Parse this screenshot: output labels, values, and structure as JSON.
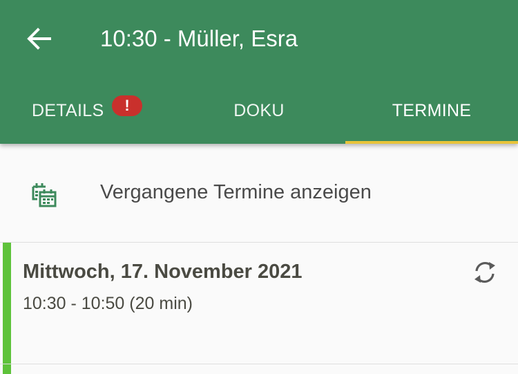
{
  "header": {
    "title": "10:30 - Müller, Esra",
    "back_icon": "arrow-left-icon",
    "background_color": "#3d8a5c"
  },
  "tabs": [
    {
      "label": "DETAILS",
      "badge": "!",
      "active": false
    },
    {
      "label": "DOKU",
      "active": false
    },
    {
      "label": "TERMINE",
      "active": true
    }
  ],
  "colors": {
    "tab_indicator": "#e8c43a",
    "badge": "#c9302c",
    "appointment_status": "#5ec23a",
    "icon_green": "#3d8a5c"
  },
  "past_appointments": {
    "label": "Vergangene Termine anzeigen",
    "icon": "calendar-history-icon"
  },
  "appointments": [
    {
      "date": "Mittwoch, 17. November 2021",
      "time": "10:30 - 10:50 (20 min)",
      "icon": "sync-icon"
    }
  ]
}
